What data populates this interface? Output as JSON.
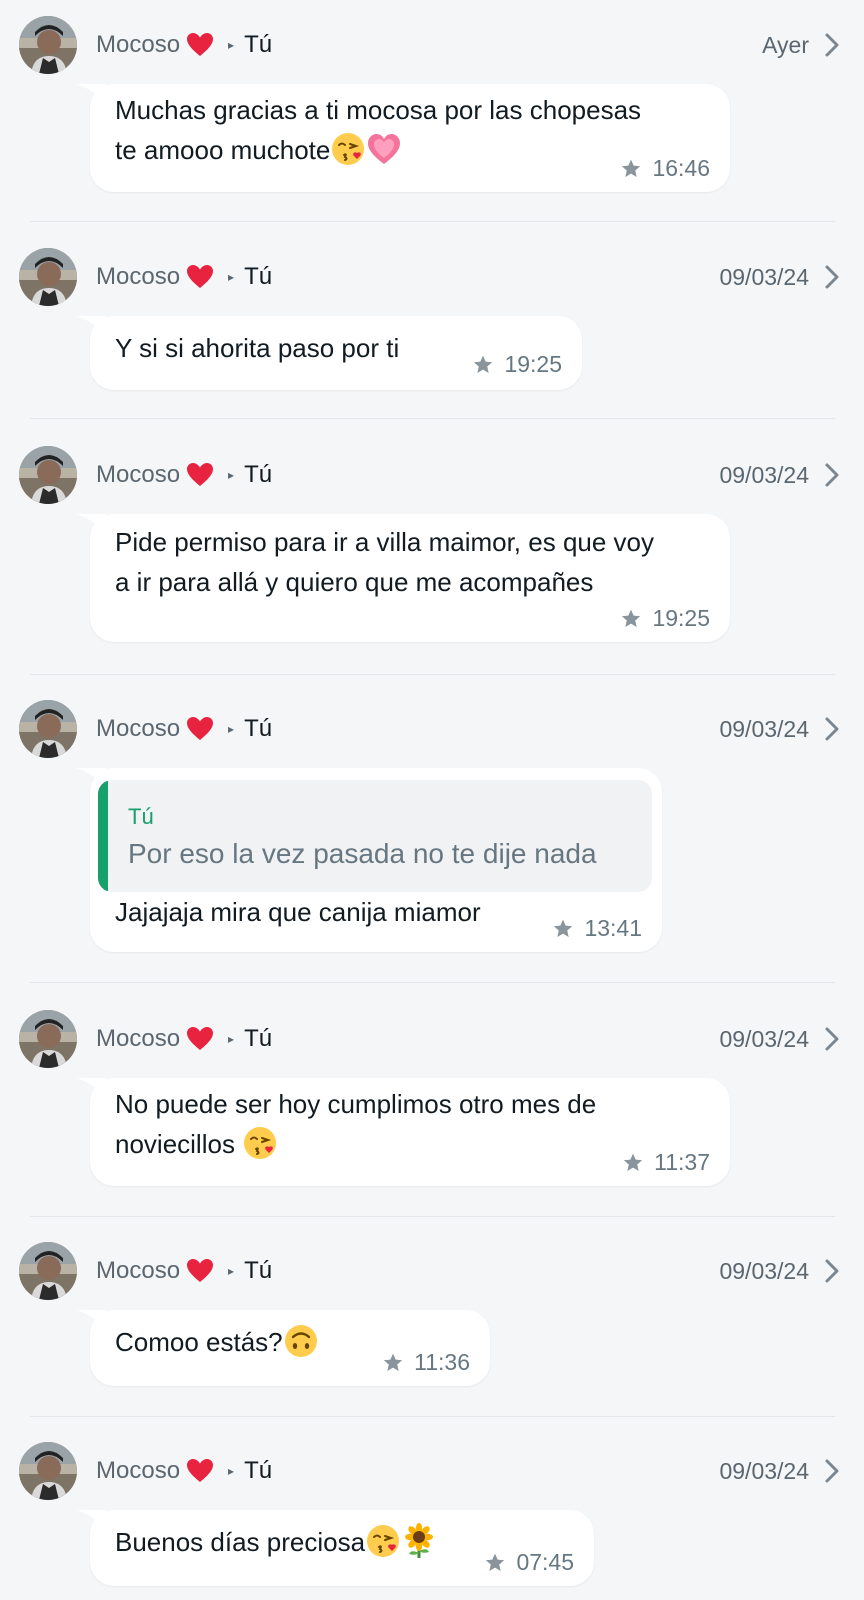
{
  "sender": "Mocoso",
  "recipient": "Tú",
  "colors": {
    "background": "#f4f6f8",
    "bubble": "#ffffff",
    "quote_accent": "#16a06b",
    "heart": "#e8233f"
  },
  "icons": {
    "heart": "red-heart-emoji",
    "arrow": "play-triangle-icon",
    "chevron": "chevron-right-icon",
    "star": "star-icon"
  },
  "messages": [
    {
      "date": "Ayer",
      "lines": [
        "Muchas gracias a ti mocosa por las chopesas",
        "te amooo muchote"
      ],
      "emojis": [
        "face-blowing-kiss",
        "growing-heart"
      ],
      "time": "16:46"
    },
    {
      "date": "09/03/24",
      "lines": [
        "Y si si ahorita paso por ti"
      ],
      "emojis": [],
      "time": "19:25"
    },
    {
      "date": "09/03/24",
      "lines": [
        "Pide permiso para ir a villa maimor, es que voy",
        "a ir para allá y quiero que me acompañes"
      ],
      "emojis": [],
      "time": "19:25"
    },
    {
      "date": "09/03/24",
      "quote": {
        "author": "Tú",
        "text": "Por eso la vez pasada no te dije nada"
      },
      "lines": [
        "Jajajaja mira que canija miamor"
      ],
      "emojis": [],
      "time": "13:41"
    },
    {
      "date": "09/03/24",
      "lines": [
        "No puede ser hoy cumplimos otro mes de",
        "noviecillos "
      ],
      "emojis": [
        "face-blowing-kiss"
      ],
      "time": "11:37"
    },
    {
      "date": "09/03/24",
      "lines": [
        "Comoo estás?"
      ],
      "emojis": [
        "upside-down-face"
      ],
      "time": "11:36"
    },
    {
      "date": "09/03/24",
      "lines": [
        "Buenos días preciosa"
      ],
      "emojis": [
        "face-blowing-kiss",
        "sunflower"
      ],
      "time": "07:45"
    }
  ]
}
